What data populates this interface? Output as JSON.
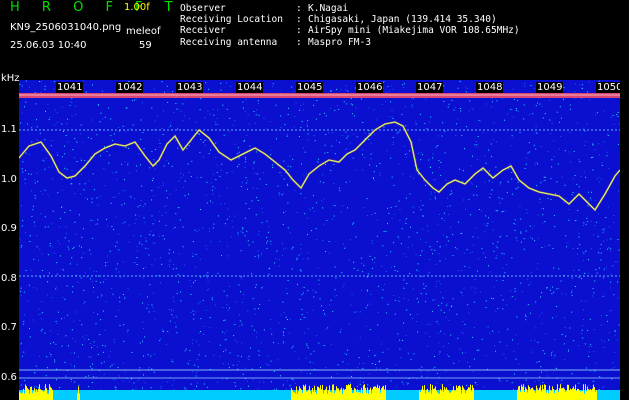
{
  "header": {
    "app_title": "H R O F F T",
    "version": "1.00f",
    "filename": "KN9_2506031040.png",
    "meleof_label": "meleof",
    "timestamp": "25.06.03 10:40",
    "meleof_value": "59",
    "info": [
      {
        "key": "Observer",
        "value": "K.Nagai"
      },
      {
        "key": "Receiving Location",
        "value": "Chigasaki, Japan (139.414 35.340)"
      },
      {
        "key": "Receiver",
        "value": "AirSpy mini (Miakejima VOR 108.65MHz)"
      },
      {
        "key": "Receiving antenna",
        "value": "Maspro FM-3"
      }
    ]
  },
  "spectrogram": {
    "y_unit": "kHz",
    "y_ticks": [
      "1.1",
      "1.0",
      "0.9",
      "0.8",
      "0.7",
      "0.6"
    ],
    "x_ticks": [
      "1041",
      "1042",
      "1043",
      "1044",
      "1045",
      "1046",
      "1047",
      "1048",
      "1049",
      "1050"
    ],
    "colors": {
      "background": "#0a0fd0",
      "noise_dot": "#22e0ff",
      "trace": "#c8ff60",
      "top_band": "#ff5060",
      "meteor_burst": "#ffff00",
      "baseline_strip": "#00ccff"
    }
  }
}
